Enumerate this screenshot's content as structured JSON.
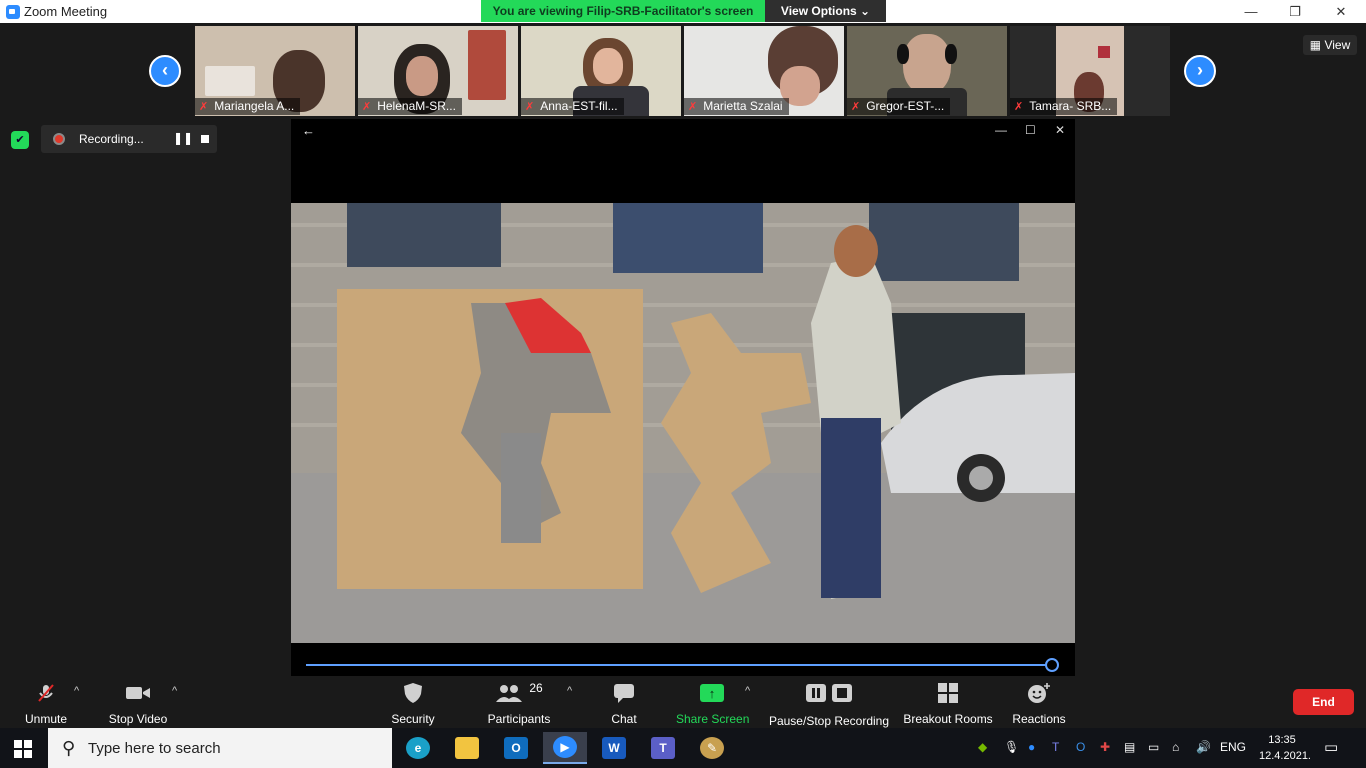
{
  "window": {
    "title": "Zoom Meeting",
    "minimize_icon": "—",
    "restore_icon": "❐",
    "close_icon": "✕"
  },
  "banner": {
    "viewing_text": "You are viewing Filip-SRB-Facilitator's screen",
    "view_options_label": "View Options ⌄"
  },
  "strip": {
    "prev_icon": "‹",
    "next_icon": "›",
    "participants": [
      {
        "name": "Mariangela A..."
      },
      {
        "name": "HelenaM-SR..."
      },
      {
        "name": "Anna-EST-fil..."
      },
      {
        "name": "Marietta Szalai"
      },
      {
        "name": "Gregor-EST-..."
      },
      {
        "name": "Tamara- SRB..."
      }
    ],
    "muted_icon": "✗"
  },
  "view_button": {
    "label": "View",
    "icon": "▦"
  },
  "recording": {
    "label": "Recording...",
    "pause_icon": "❚❚"
  },
  "share_window": {
    "back_icon": "←",
    "min_icon": "—",
    "max_icon": "☐",
    "close_icon": "✕"
  },
  "toolbar": {
    "unmute": "Unmute",
    "stop_video": "Stop Video",
    "security": "Security",
    "participants": "Participants",
    "participant_count": "26",
    "chat": "Chat",
    "share_screen": "Share Screen",
    "pause_stop_recording": "Pause/Stop Recording",
    "breakout_rooms": "Breakout Rooms",
    "reactions": "Reactions",
    "end": "End",
    "caret": "^"
  },
  "taskbar": {
    "search_placeholder": "Type here to search",
    "language": "ENG",
    "time": "13:35",
    "date": "12.4.2021."
  },
  "colors": {
    "accent": "#2d8cff",
    "banner_green": "#23d959",
    "end_red": "#e02828"
  }
}
